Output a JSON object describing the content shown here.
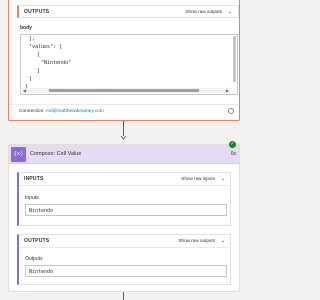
{
  "top_card": {
    "outputs_title": "OUTPUTS",
    "show_raw": "Show raw outputs",
    "body_label": "body",
    "code_lines": [
      "],",
      "\"values\": [",
      "{",
      "\"Nintendo\"",
      "]",
      "]",
      "}"
    ],
    "connection_label": "Connection:",
    "connection_email": "md@matthewdevaney.com"
  },
  "compose": {
    "title": "Compose: Cell Value",
    "duration": "0s",
    "icon_glyph": "{x}",
    "inputs": {
      "title": "INPUTS",
      "show_raw": "Show raw inputs",
      "field_label": "Inputs",
      "field_value": "Nintendo"
    },
    "outputs": {
      "title": "OUTPUTS",
      "show_raw": "Show raw outputs",
      "field_label": "Outputs",
      "field_value": "Nintendo"
    }
  },
  "colors": {
    "accent_orange": "#e8825e",
    "compose_purple": "#8c6cd0",
    "compose_header": "#e3dcf3",
    "link_blue": "#0078d4",
    "success_green": "#0e8a16"
  },
  "icons": {
    "chevron": "chevron-down-icon",
    "check": "check-icon",
    "compose": "compose-variable-icon",
    "connection_info": "info-icon"
  }
}
